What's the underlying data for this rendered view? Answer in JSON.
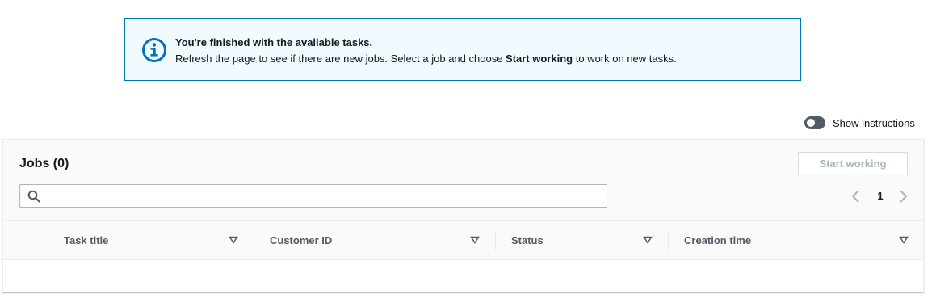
{
  "alert": {
    "icon": "info-circle-icon",
    "title": "You're finished with the available tasks.",
    "body_prefix": "Refresh the page to see if there are new jobs. Select a job and choose ",
    "body_emphasis": "Start working",
    "body_suffix": " to work on new tasks.",
    "accent_color": "#0073bb"
  },
  "instructions_toggle": {
    "label": "Show instructions",
    "checked": false
  },
  "jobs": {
    "title": "Jobs (0)",
    "start_button_label": "Start working",
    "search": {
      "placeholder": "",
      "value": ""
    },
    "pagination": {
      "current_page": "1"
    },
    "columns": [
      "Task title",
      "Customer ID",
      "Status",
      "Creation time"
    ],
    "rows": []
  }
}
